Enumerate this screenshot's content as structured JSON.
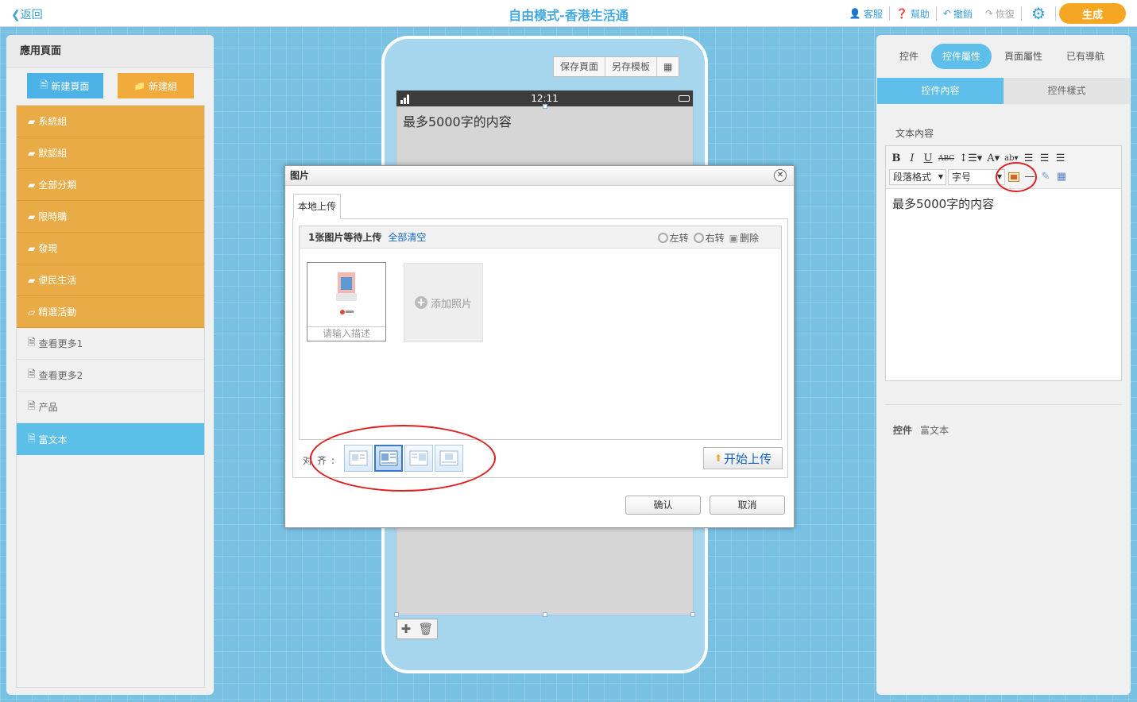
{
  "topbar": {
    "back_label": "返回",
    "title": "自由模式-香港生活通",
    "service_label": "客服",
    "help_label": "幫助",
    "undo_label": "撤銷",
    "redo_label": "恢復",
    "generate_label": "生成"
  },
  "left_panel": {
    "title": "應用頁面",
    "new_page_label": "新建頁面",
    "new_group_label": "新建組",
    "groups": [
      {
        "label": "系統組"
      },
      {
        "label": "默認組"
      },
      {
        "label": "全部分類"
      },
      {
        "label": "限時購"
      },
      {
        "label": "發現"
      },
      {
        "label": "便民生活"
      },
      {
        "label": "精選活動"
      }
    ],
    "pages": [
      {
        "label": "查看更多1"
      },
      {
        "label": "查看更多2"
      },
      {
        "label": "产品"
      },
      {
        "label": "富文本"
      }
    ]
  },
  "phone": {
    "save_page_label": "保存頁面",
    "save_template_label": "另存模板",
    "time": "12:11",
    "content_text": "最多5000字的内容"
  },
  "right_panel": {
    "tabs": [
      {
        "label": "控件"
      },
      {
        "label": "控件屬性"
      },
      {
        "label": "頁面屬性"
      },
      {
        "label": "已有導航"
      }
    ],
    "subtabs": [
      {
        "label": "控件內容"
      },
      {
        "label": "控件樣式"
      }
    ],
    "text_content_label": "文本內容",
    "paragraph_format": "段落格式",
    "font_size": "字号",
    "editor_text": "最多5000字的内容",
    "widget_label": "控件",
    "widget_value": "富文本"
  },
  "dialog": {
    "title": "图片",
    "tab_label": "本地上传",
    "pending_text": "1张图片等待上传",
    "clear_all_label": "全部清空",
    "rotate_left_label": "左转",
    "rotate_right_label": "右转",
    "delete_label": "删除",
    "desc_placeholder": "请输入描述",
    "add_photo_label": "添加照片",
    "align_label": "对齐:",
    "start_upload_label": "开始上传",
    "confirm_label": "确认",
    "cancel_label": "取消"
  },
  "colors": {
    "accent_blue": "#5ec0ea",
    "group_orange": "#e8ab45",
    "generate_orange": "#f5a623",
    "annotation_red": "#e02020"
  }
}
